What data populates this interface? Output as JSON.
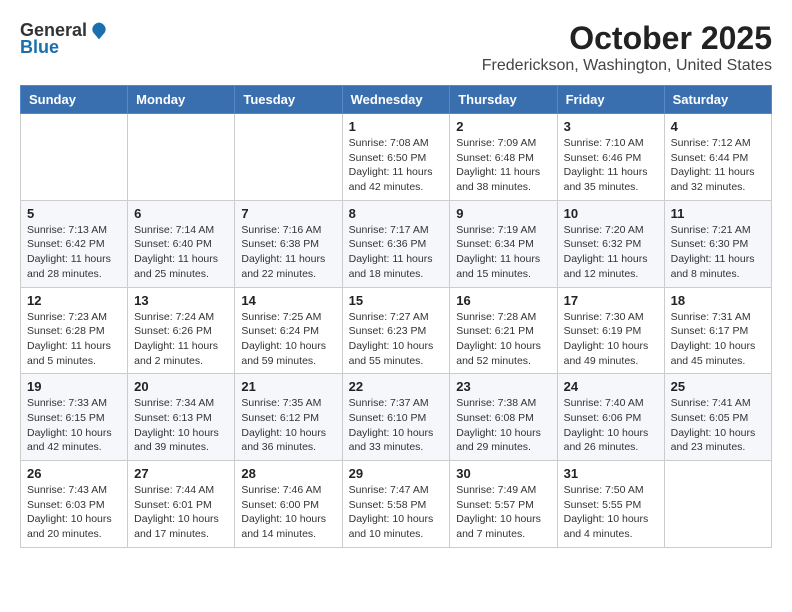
{
  "logo": {
    "general": "General",
    "blue": "Blue"
  },
  "title": "October 2025",
  "location": "Frederickson, Washington, United States",
  "headers": [
    "Sunday",
    "Monday",
    "Tuesday",
    "Wednesday",
    "Thursday",
    "Friday",
    "Saturday"
  ],
  "weeks": [
    [
      {
        "day": "",
        "sunrise": "",
        "sunset": "",
        "daylight": ""
      },
      {
        "day": "",
        "sunrise": "",
        "sunset": "",
        "daylight": ""
      },
      {
        "day": "",
        "sunrise": "",
        "sunset": "",
        "daylight": ""
      },
      {
        "day": "1",
        "sunrise": "Sunrise: 7:08 AM",
        "sunset": "Sunset: 6:50 PM",
        "daylight": "Daylight: 11 hours and 42 minutes."
      },
      {
        "day": "2",
        "sunrise": "Sunrise: 7:09 AM",
        "sunset": "Sunset: 6:48 PM",
        "daylight": "Daylight: 11 hours and 38 minutes."
      },
      {
        "day": "3",
        "sunrise": "Sunrise: 7:10 AM",
        "sunset": "Sunset: 6:46 PM",
        "daylight": "Daylight: 11 hours and 35 minutes."
      },
      {
        "day": "4",
        "sunrise": "Sunrise: 7:12 AM",
        "sunset": "Sunset: 6:44 PM",
        "daylight": "Daylight: 11 hours and 32 minutes."
      }
    ],
    [
      {
        "day": "5",
        "sunrise": "Sunrise: 7:13 AM",
        "sunset": "Sunset: 6:42 PM",
        "daylight": "Daylight: 11 hours and 28 minutes."
      },
      {
        "day": "6",
        "sunrise": "Sunrise: 7:14 AM",
        "sunset": "Sunset: 6:40 PM",
        "daylight": "Daylight: 11 hours and 25 minutes."
      },
      {
        "day": "7",
        "sunrise": "Sunrise: 7:16 AM",
        "sunset": "Sunset: 6:38 PM",
        "daylight": "Daylight: 11 hours and 22 minutes."
      },
      {
        "day": "8",
        "sunrise": "Sunrise: 7:17 AM",
        "sunset": "Sunset: 6:36 PM",
        "daylight": "Daylight: 11 hours and 18 minutes."
      },
      {
        "day": "9",
        "sunrise": "Sunrise: 7:19 AM",
        "sunset": "Sunset: 6:34 PM",
        "daylight": "Daylight: 11 hours and 15 minutes."
      },
      {
        "day": "10",
        "sunrise": "Sunrise: 7:20 AM",
        "sunset": "Sunset: 6:32 PM",
        "daylight": "Daylight: 11 hours and 12 minutes."
      },
      {
        "day": "11",
        "sunrise": "Sunrise: 7:21 AM",
        "sunset": "Sunset: 6:30 PM",
        "daylight": "Daylight: 11 hours and 8 minutes."
      }
    ],
    [
      {
        "day": "12",
        "sunrise": "Sunrise: 7:23 AM",
        "sunset": "Sunset: 6:28 PM",
        "daylight": "Daylight: 11 hours and 5 minutes."
      },
      {
        "day": "13",
        "sunrise": "Sunrise: 7:24 AM",
        "sunset": "Sunset: 6:26 PM",
        "daylight": "Daylight: 11 hours and 2 minutes."
      },
      {
        "day": "14",
        "sunrise": "Sunrise: 7:25 AM",
        "sunset": "Sunset: 6:24 PM",
        "daylight": "Daylight: 10 hours and 59 minutes."
      },
      {
        "day": "15",
        "sunrise": "Sunrise: 7:27 AM",
        "sunset": "Sunset: 6:23 PM",
        "daylight": "Daylight: 10 hours and 55 minutes."
      },
      {
        "day": "16",
        "sunrise": "Sunrise: 7:28 AM",
        "sunset": "Sunset: 6:21 PM",
        "daylight": "Daylight: 10 hours and 52 minutes."
      },
      {
        "day": "17",
        "sunrise": "Sunrise: 7:30 AM",
        "sunset": "Sunset: 6:19 PM",
        "daylight": "Daylight: 10 hours and 49 minutes."
      },
      {
        "day": "18",
        "sunrise": "Sunrise: 7:31 AM",
        "sunset": "Sunset: 6:17 PM",
        "daylight": "Daylight: 10 hours and 45 minutes."
      }
    ],
    [
      {
        "day": "19",
        "sunrise": "Sunrise: 7:33 AM",
        "sunset": "Sunset: 6:15 PM",
        "daylight": "Daylight: 10 hours and 42 minutes."
      },
      {
        "day": "20",
        "sunrise": "Sunrise: 7:34 AM",
        "sunset": "Sunset: 6:13 PM",
        "daylight": "Daylight: 10 hours and 39 minutes."
      },
      {
        "day": "21",
        "sunrise": "Sunrise: 7:35 AM",
        "sunset": "Sunset: 6:12 PM",
        "daylight": "Daylight: 10 hours and 36 minutes."
      },
      {
        "day": "22",
        "sunrise": "Sunrise: 7:37 AM",
        "sunset": "Sunset: 6:10 PM",
        "daylight": "Daylight: 10 hours and 33 minutes."
      },
      {
        "day": "23",
        "sunrise": "Sunrise: 7:38 AM",
        "sunset": "Sunset: 6:08 PM",
        "daylight": "Daylight: 10 hours and 29 minutes."
      },
      {
        "day": "24",
        "sunrise": "Sunrise: 7:40 AM",
        "sunset": "Sunset: 6:06 PM",
        "daylight": "Daylight: 10 hours and 26 minutes."
      },
      {
        "day": "25",
        "sunrise": "Sunrise: 7:41 AM",
        "sunset": "Sunset: 6:05 PM",
        "daylight": "Daylight: 10 hours and 23 minutes."
      }
    ],
    [
      {
        "day": "26",
        "sunrise": "Sunrise: 7:43 AM",
        "sunset": "Sunset: 6:03 PM",
        "daylight": "Daylight: 10 hours and 20 minutes."
      },
      {
        "day": "27",
        "sunrise": "Sunrise: 7:44 AM",
        "sunset": "Sunset: 6:01 PM",
        "daylight": "Daylight: 10 hours and 17 minutes."
      },
      {
        "day": "28",
        "sunrise": "Sunrise: 7:46 AM",
        "sunset": "Sunset: 6:00 PM",
        "daylight": "Daylight: 10 hours and 14 minutes."
      },
      {
        "day": "29",
        "sunrise": "Sunrise: 7:47 AM",
        "sunset": "Sunset: 5:58 PM",
        "daylight": "Daylight: 10 hours and 10 minutes."
      },
      {
        "day": "30",
        "sunrise": "Sunrise: 7:49 AM",
        "sunset": "Sunset: 5:57 PM",
        "daylight": "Daylight: 10 hours and 7 minutes."
      },
      {
        "day": "31",
        "sunrise": "Sunrise: 7:50 AM",
        "sunset": "Sunset: 5:55 PM",
        "daylight": "Daylight: 10 hours and 4 minutes."
      },
      {
        "day": "",
        "sunrise": "",
        "sunset": "",
        "daylight": ""
      }
    ]
  ]
}
